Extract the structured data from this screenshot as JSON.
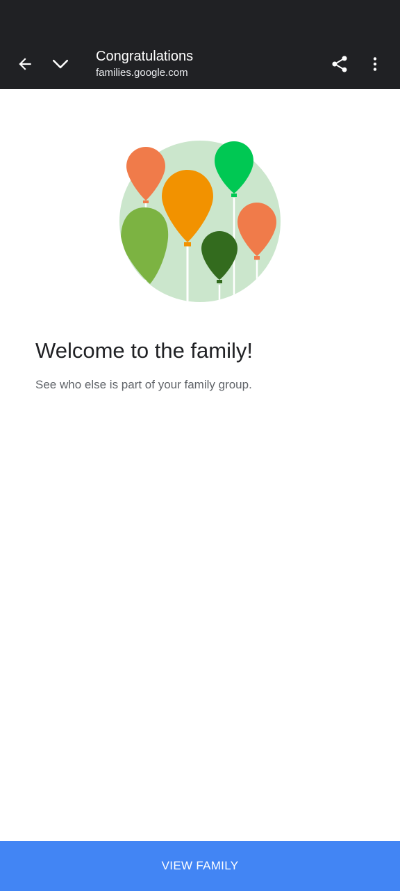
{
  "app_bar": {
    "title": "Congratulations",
    "url": "families.google.com",
    "icons": {
      "back": "arrow-back-icon",
      "collapse": "chevron-down-icon",
      "share": "share-icon",
      "more": "more-vert-icon"
    }
  },
  "main": {
    "illustration": "balloons-illustration",
    "heading": "Welcome to the family!",
    "subtext": "See who else is part of your family group."
  },
  "footer": {
    "button_label": "VIEW FAMILY"
  },
  "colors": {
    "toolbar_bg": "#202124",
    "accent": "#4285f4",
    "heading_text": "#202124",
    "body_text": "#5f6368",
    "balloon_orange": "#f07b4a",
    "balloon_amber": "#f29200",
    "balloon_green": "#00c853",
    "balloon_light_green": "#7cb342",
    "balloon_dark_green": "#336b1e",
    "circle_bg": "#cbe6cc"
  }
}
